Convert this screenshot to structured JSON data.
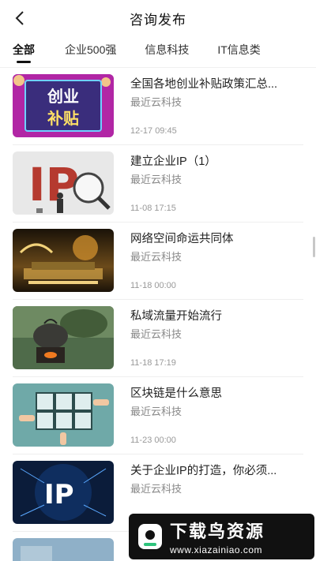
{
  "header": {
    "title": "咨询发布",
    "back_icon": "chevron-left-icon"
  },
  "tabs": [
    {
      "label": "全部",
      "active": true
    },
    {
      "label": "企业500强",
      "active": false
    },
    {
      "label": "信息科技",
      "active": false
    },
    {
      "label": "IT信息类",
      "active": false
    }
  ],
  "articles": [
    {
      "title": "全国各地创业补贴政策汇总...",
      "source": "最近云科技",
      "time": "12-17 09:45",
      "thumb_text": [
        "创业",
        "补贴"
      ]
    },
    {
      "title": "建立企业IP（1）",
      "source": "最近云科技",
      "time": "11-08 17:15",
      "thumb_text": [
        "IP"
      ]
    },
    {
      "title": "网络空间命运共同体",
      "source": "最近云科技",
      "time": "11-18 00:00"
    },
    {
      "title": "私域流量开始流行",
      "source": "最近云科技",
      "time": "11-18 17:19"
    },
    {
      "title": "区块链是什么意思",
      "source": "最近云科技",
      "time": "11-23 00:00"
    },
    {
      "title": "关于企业IP的打造，你必须...",
      "source": "最近云科技",
      "time": "",
      "thumb_text": [
        "IP"
      ]
    }
  ],
  "watermark": {
    "title": "下载鸟资源",
    "url": "www.xiazainiao.com"
  }
}
